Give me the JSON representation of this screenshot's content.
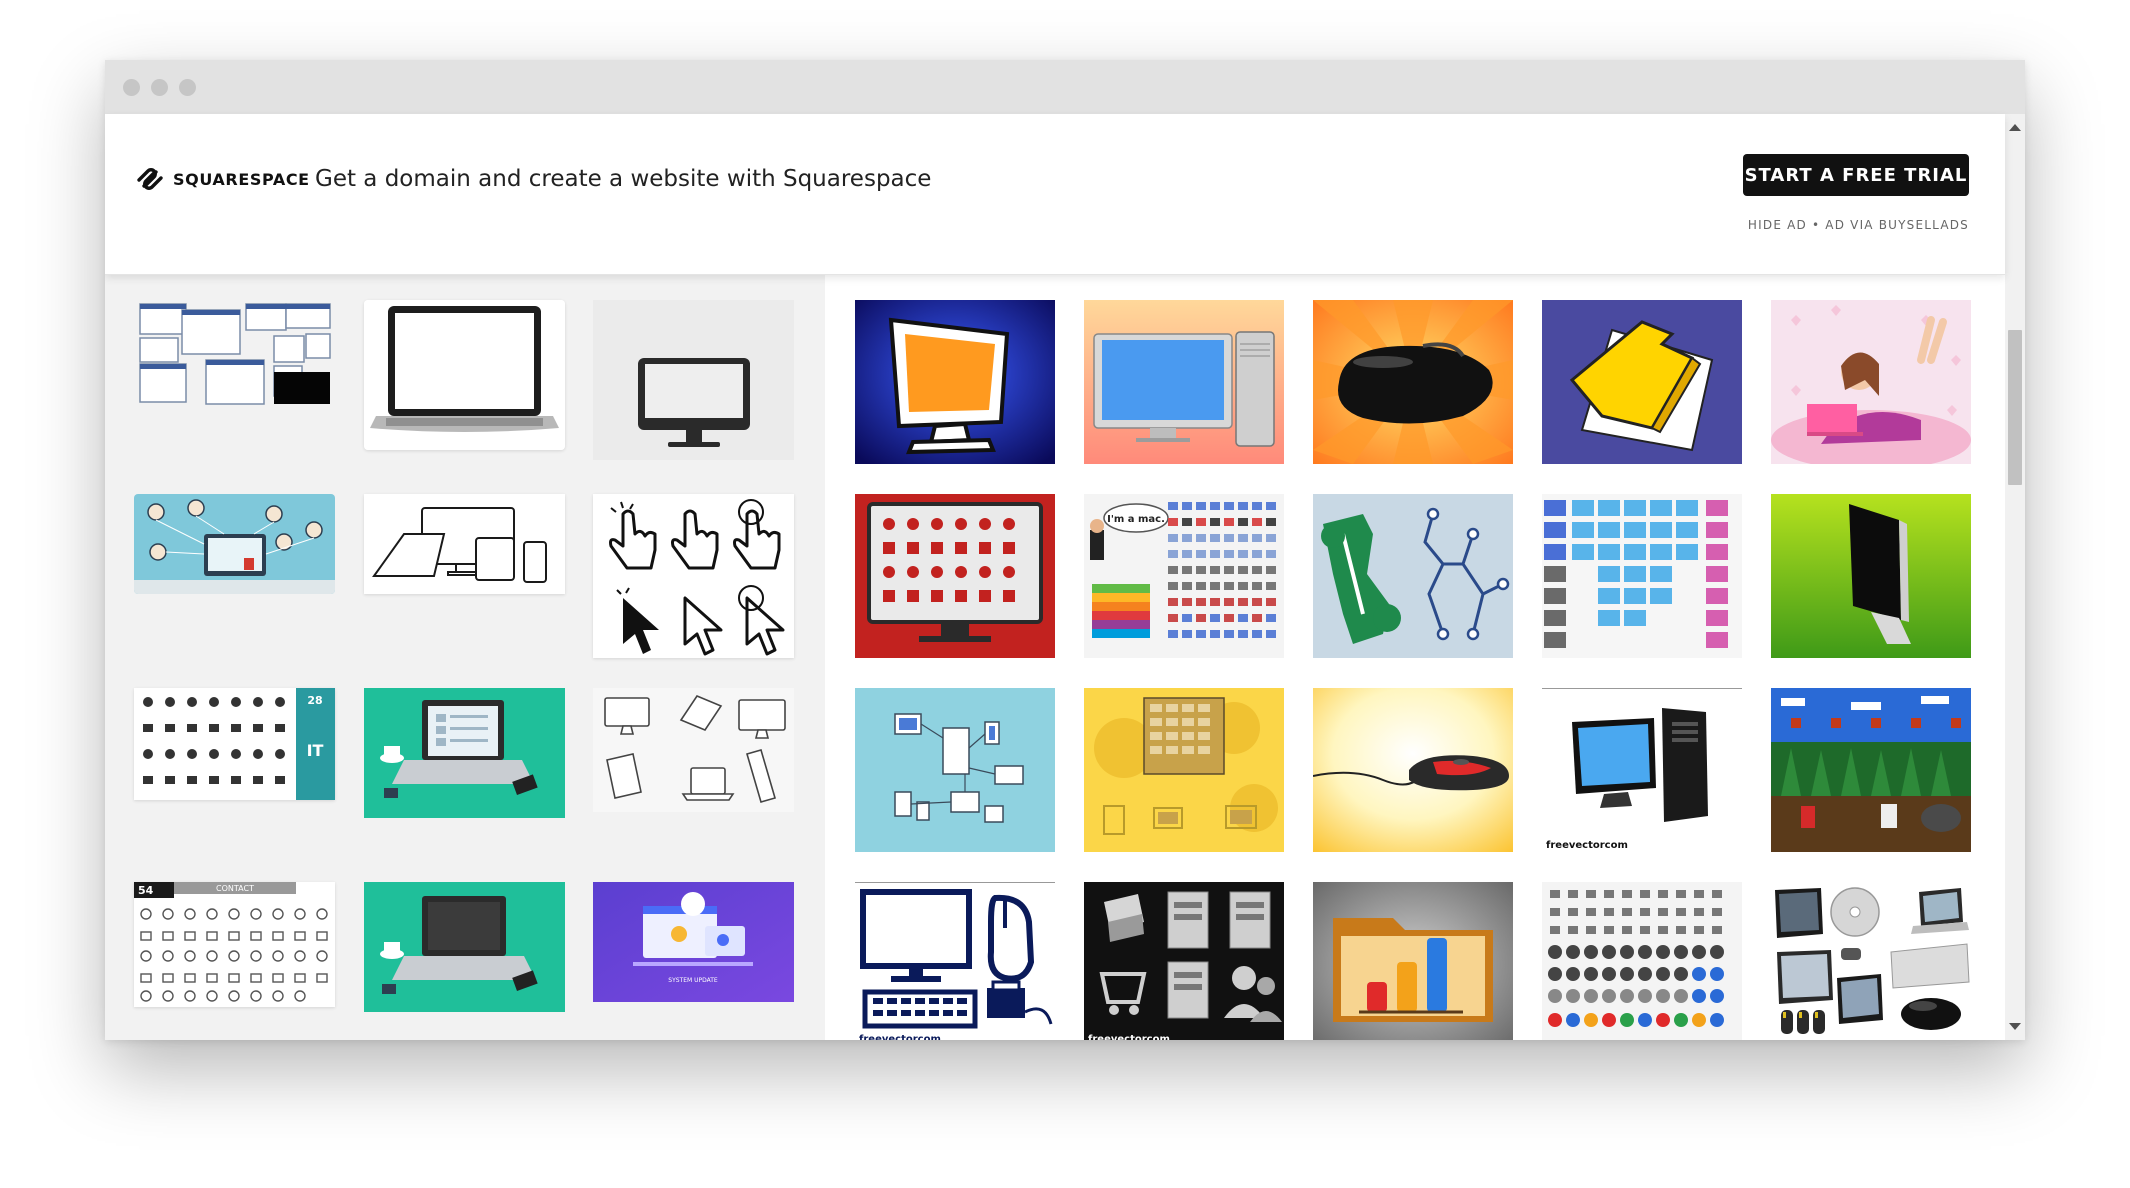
{
  "ad": {
    "brand": "SQUARESPACE",
    "tagline": "Get a domain and create a website with Squarespace",
    "cta_label": "START A FREE TRIAL",
    "hide_label": "HIDE AD",
    "separator": "•",
    "via_label": "AD VIA BUYSELLADS"
  },
  "thumbs": {
    "im_a_mac": "I'm a mac.",
    "watermark": "freevectorcom",
    "system_update": "SYSTEM UPDATE",
    "it_badge": "28",
    "it_label": "IT",
    "icons_count": "54",
    "contact_label": "CONTACT"
  },
  "colors": {
    "cta_bg": "#111111",
    "teal": "#1fbf9a",
    "purple": "#6a3fd6",
    "lime": "#6fbf1c"
  },
  "icons": [
    "squarespace-logo-icon",
    "scroll-up-icon",
    "scroll-down-icon"
  ]
}
